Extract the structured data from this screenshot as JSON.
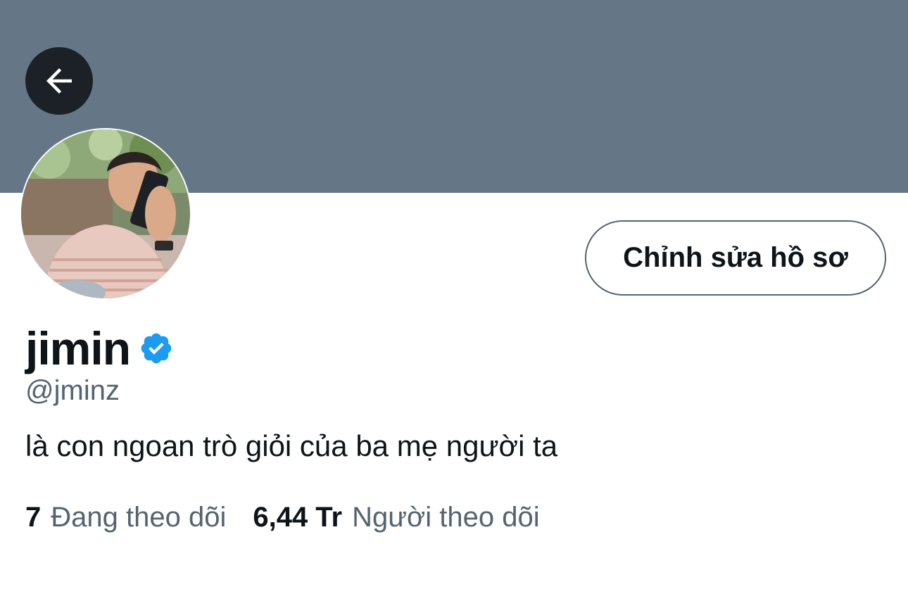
{
  "profile": {
    "display_name": "jimin",
    "handle": "@jminz",
    "bio": "là con ngoan trò giỏi của ba mẹ người ta",
    "verified": true,
    "edit_button_label": "Chỉnh sửa hồ sơ"
  },
  "stats": {
    "following_count": "7",
    "following_label": "Đang theo dõi",
    "followers_count": "6,44 Tr",
    "followers_label": "Người theo dõi"
  },
  "icons": {
    "back": "arrow-left-icon",
    "verified": "verified-badge-icon"
  },
  "colors": {
    "banner": "#657786",
    "verified_blue": "#1d9bf0",
    "text_primary": "#0f1419",
    "text_secondary": "#536471"
  }
}
